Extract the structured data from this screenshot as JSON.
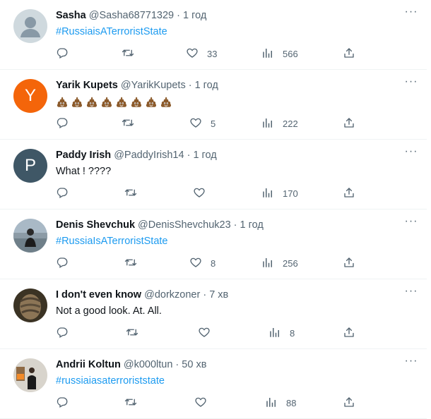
{
  "tweets": [
    {
      "name": "Sasha",
      "handle": "@Sasha68771329",
      "time": "1 год",
      "text": "#RussiaisATerroristState",
      "text_style": "hashtag",
      "likes": "33",
      "views": "566",
      "avatar": "default-gray"
    },
    {
      "name": "Yarik Kupets",
      "handle": "@YarikKupets",
      "time": "1 год",
      "text": "💩💩💩💩💩💩💩💩",
      "text_style": "emoji",
      "likes": "5",
      "views": "222",
      "avatar": "letter",
      "avatar_letter": "Y",
      "avatar_color": "#f4650a"
    },
    {
      "name": "Paddy Irish",
      "handle": "@PaddyIrish14",
      "time": "1 год",
      "text": "What ! ????",
      "text_style": "plain",
      "likes": "",
      "views": "170",
      "avatar": "letter",
      "avatar_letter": "P",
      "avatar_color": "#3f5766"
    },
    {
      "name": "Denis Shevchuk",
      "handle": "@DenisShevchuk23",
      "time": "1 год",
      "text": "#RussiaIsATerroristState",
      "text_style": "hashtag",
      "likes": "8",
      "views": "256",
      "avatar": "photo-landscape"
    },
    {
      "name": "I don't even know",
      "handle": "@dorkzoner",
      "time": "7 хв",
      "text": "Not a good look. At. All.",
      "text_style": "plain",
      "likes": "",
      "views": "8",
      "avatar": "photo-face"
    },
    {
      "name": "Andrii Koltun",
      "handle": "@k000ltun",
      "time": "50 хв",
      "text": "#russiaiasaterroriststate",
      "text_style": "hashtag",
      "likes": "",
      "views": "88",
      "avatar": "photo-person"
    }
  ],
  "icons": {
    "reply": "reply-icon",
    "retweet": "retweet-icon",
    "like": "heart-icon",
    "views": "views-icon",
    "share": "share-icon",
    "more": "more-icon"
  },
  "colors": {
    "hashtag": "#1d9bf0",
    "secondary": "#536471",
    "primary": "#0f1419"
  }
}
